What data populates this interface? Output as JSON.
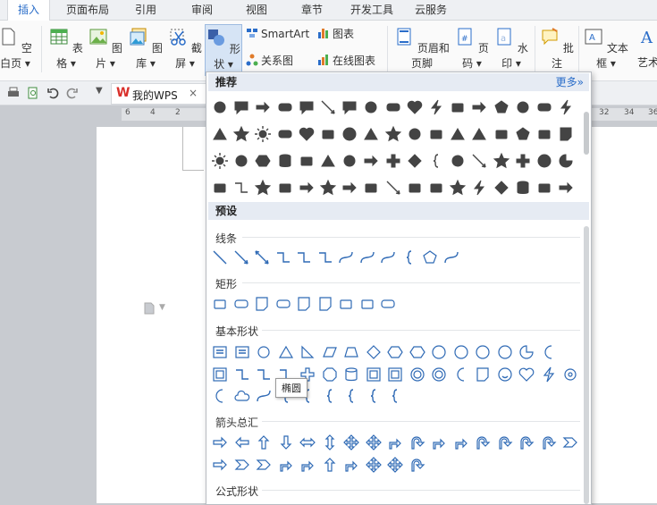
{
  "tabs": [
    "插入",
    "页面布局",
    "引用",
    "审阅",
    "视图",
    "章节",
    "开发工具",
    "云服务"
  ],
  "ribbon": {
    "blank_page": "空白页",
    "table": "表格",
    "picture": "图片",
    "gallery": "图库",
    "screenshot": "截屏",
    "shapes": "形状",
    "smartart": "SmartArt",
    "chart": "图表",
    "relation": "关系图",
    "online_chart": "在线图表",
    "header_footer": "页眉和页脚",
    "page_number": "页码",
    "watermark": "水印",
    "comment": "批注",
    "textbox": "文本框",
    "art": "艺术"
  },
  "quickbar": {
    "mywps": "我的WPS",
    "close": "×"
  },
  "ruler": {
    "left": [
      "6",
      "4",
      "2"
    ],
    "right": [
      "32",
      "34",
      "36"
    ]
  },
  "dropdown": {
    "recommended": "推荐",
    "more": "更多»",
    "preset": "预设",
    "categories": {
      "lines": "线条",
      "rects": "矩形",
      "basic": "基本形状",
      "arrows": "箭头总汇",
      "formula": "公式形状"
    },
    "tooltip": "椭圆"
  },
  "colors": {
    "accent": "#2a6dc9",
    "shape_dark": "#444444",
    "shape_outline": "#2f6ab5"
  }
}
